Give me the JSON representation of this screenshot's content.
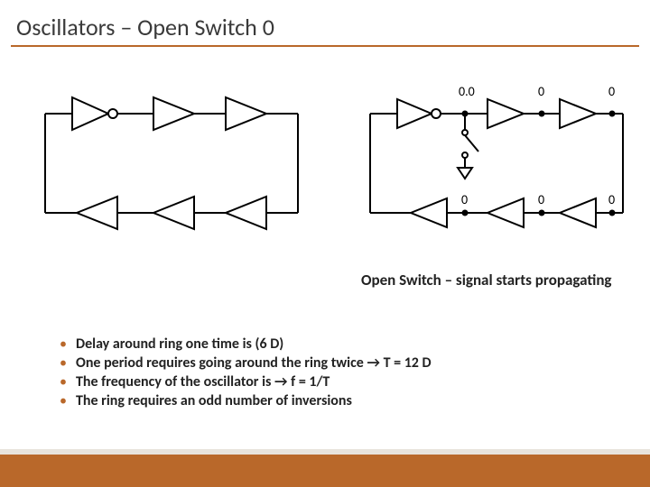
{
  "title": "Oscillators – Open Switch 0",
  "caption": "Open Switch – signal starts propagating",
  "right_labels": {
    "in": "0.0",
    "a": "0",
    "b": "0",
    "c": "0",
    "d": "0",
    "e": "0"
  },
  "bullets": [
    "Delay around ring one time is (6 D)",
    "One period requires going around the ring twice → T = 12 D",
    "The frequency of the oscillator is → f = 1/T",
    "The ring requires an odd number of inversions"
  ]
}
